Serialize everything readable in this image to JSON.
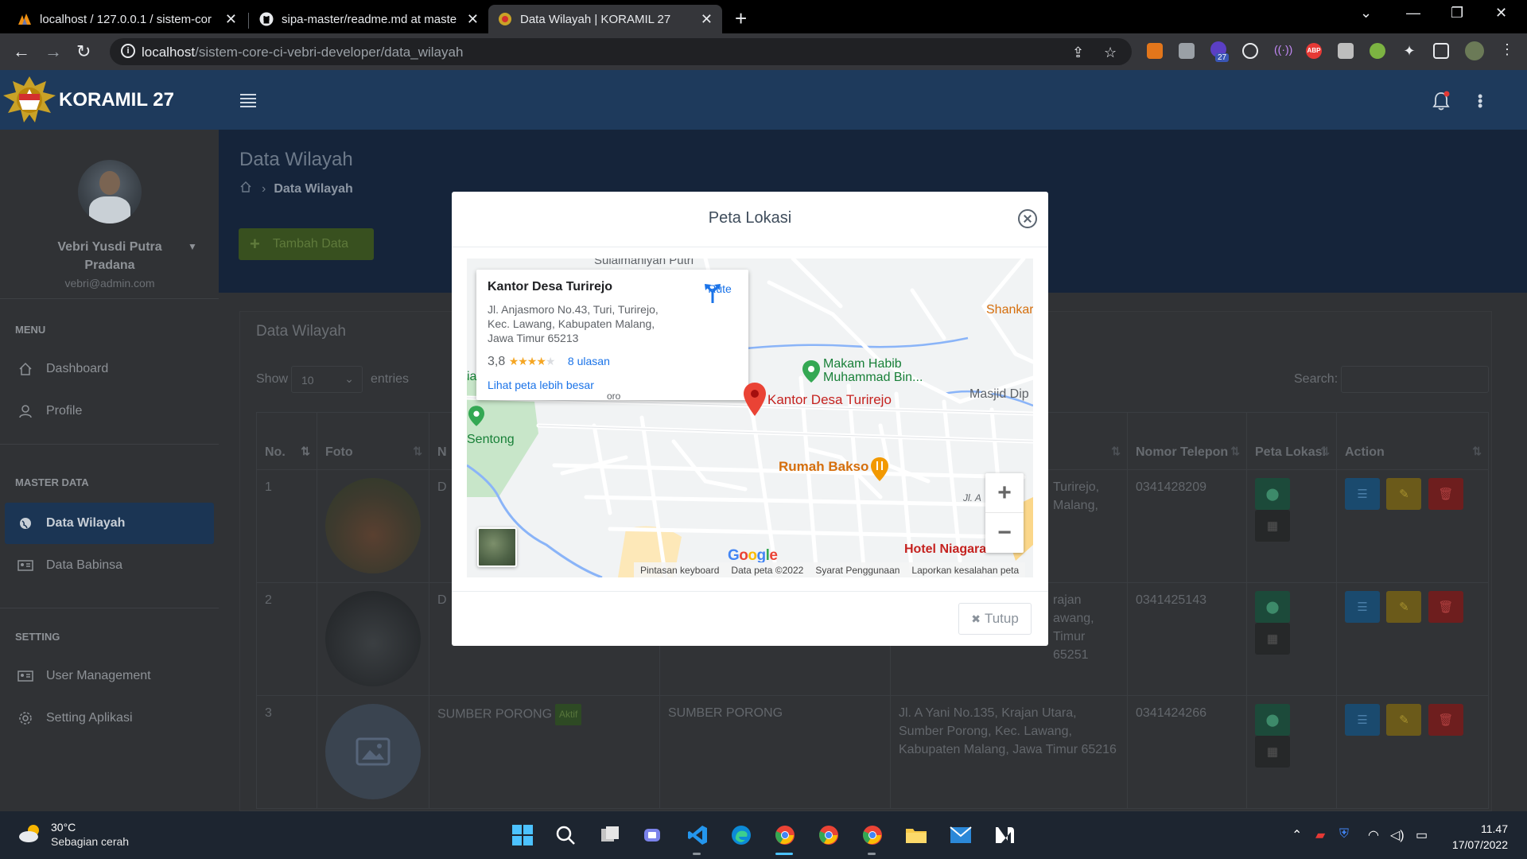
{
  "browser": {
    "tabs": [
      {
        "title": "localhost / 127.0.0.1 / sistem-cor",
        "active": false
      },
      {
        "title": "sipa-master/readme.md at maste",
        "active": false
      },
      {
        "title": "Data Wilayah | KORAMIL 27",
        "active": true
      }
    ],
    "url_host": "localhost",
    "url_path": "/sistem-core-ci-vebri-developer/data_wilayah",
    "extension_badge": "27"
  },
  "app": {
    "brand": "KORAMIL 27"
  },
  "sidebar": {
    "user_name": "Vebri Yusdi Putra Pradana",
    "user_email": "vebri@admin.com",
    "sections": {
      "menu": "MENU",
      "master": "MASTER DATA",
      "setting": "SETTING"
    },
    "items": [
      {
        "label": "Dashboard",
        "icon": "home-icon"
      },
      {
        "label": "Profile",
        "icon": "user-icon"
      },
      {
        "label": "Data Wilayah",
        "icon": "globe-icon",
        "active": true
      },
      {
        "label": "Data Babinsa",
        "icon": "id-card-icon"
      },
      {
        "label": "User Management",
        "icon": "id-card-icon"
      },
      {
        "label": "Setting Aplikasi",
        "icon": "gear-icon"
      }
    ]
  },
  "page": {
    "title": "Data Wilayah",
    "breadcrumb": "Data Wilayah",
    "add_button": "Tambah Data",
    "card_title": "Data Wilayah",
    "show_label": "Show",
    "show_value": "10",
    "entries_label": "entries",
    "search_label": "Search:"
  },
  "table": {
    "headers": [
      "No.",
      "Foto",
      "N",
      "",
      "",
      "Nomor Telepon",
      "Peta Lokasi",
      "Action"
    ],
    "rows": [
      {
        "no": "1",
        "name": "D",
        "desa": "",
        "address": "Turirejo, Malang,",
        "phone": "0341428209"
      },
      {
        "no": "2",
        "name": "D",
        "desa": "",
        "address": "rajan awang, Timur 65251",
        "phone": "0341425143"
      },
      {
        "no": "3",
        "name": "SUMBER PORONG",
        "badge": "Aktif",
        "desa": "SUMBER PORONG",
        "address": "Jl. A Yani No.135, Krajan Utara, Sumber Porong, Kec. Lawang, Kabupaten Malang, Jawa Timur 65216",
        "phone": "0341424266"
      }
    ]
  },
  "modal": {
    "title": "Peta Lokasi",
    "close_button": "Tutup",
    "map": {
      "place_name": "Kantor Desa Turirejo",
      "address": "Jl. Anjasmoro No.43, Turi, Turirejo, Kec. Lawang, Kabupaten Malang, Jawa Timur 65213",
      "rating": "3,8",
      "reviews": "8 ulasan",
      "larger_map": "Lihat peta lebih besar",
      "route": "Rute",
      "marker_label": "Kantor Desa Turirejo",
      "labels": {
        "top": "Sulaimaniyah Putri",
        "shankar": "Shankar",
        "makam": "Makam Habib Muhammad Bin...",
        "masjid": "Masjid Dip",
        "sentong": "Sentong",
        "ia": "ia",
        "rumah_bakso": "Rumah Bakso",
        "hotel": "Hotel Niagara",
        "jl": "Jl. A",
        "oro": "oro"
      },
      "attribution": [
        "Pintasan keyboard",
        "Data peta ©2022",
        "Syarat Penggunaan",
        "Laporkan kesalahan peta"
      ],
      "google": "Google"
    }
  },
  "taskbar": {
    "temperature": "30°C",
    "weather": "Sebagian cerah",
    "time": "11.47",
    "date": "17/07/2022"
  },
  "colors": {
    "header": "#1e3a5c",
    "sidebar_active": "#1b3554",
    "map_marker": "#ea4335",
    "link": "#1a73e8"
  }
}
